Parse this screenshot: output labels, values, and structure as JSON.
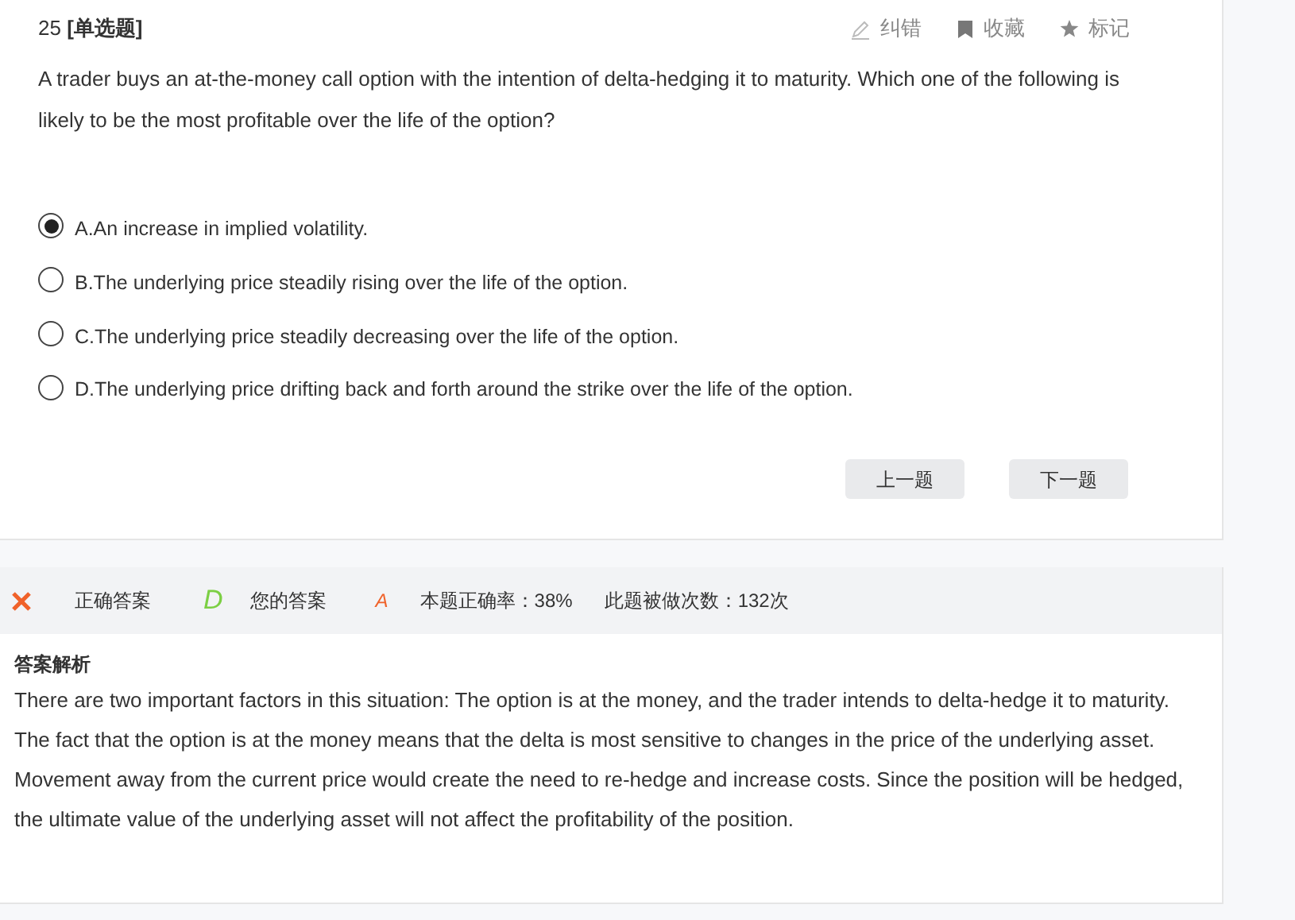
{
  "question": {
    "number": "25",
    "type": "[单选题]",
    "text": "A trader buys an at-the-money call option with the intention of delta-hedging it to maturity. Which one of the following is likely to be the most profitable over the life of the option?"
  },
  "actions": [
    {
      "kind": "report",
      "label": "纠错"
    },
    {
      "kind": "bookmark",
      "label": "收藏"
    },
    {
      "kind": "star",
      "label": "标记"
    }
  ],
  "options": [
    {
      "label": "A.An increase in implied volatility.",
      "selected": true
    },
    {
      "label": "B.The underlying price steadily rising over the life of the option.",
      "selected": false
    },
    {
      "label": "C.The underlying price steadily decreasing over the life of the option.",
      "selected": false
    },
    {
      "label": "D.The underlying price drifting back and forth around the strike over the life of the option.",
      "selected": false
    }
  ],
  "buttons": [
    "上一题",
    "下一题"
  ],
  "result": {
    "correct": false,
    "correct_answer": "D",
    "correct_label": "正确答案",
    "your_answer": "A",
    "your_label": "您的答案",
    "accuracy": "本题正确率：38%",
    "count": "此题被做次数：132次"
  },
  "analysis": {
    "title": "答案解析",
    "text": "There are two important factors in this situation: The option is at the money, and the trader intends to delta-hedge it to maturity. The fact that the option is at the money means that the delta is most sensitive to changes in the price of the underlying asset. Movement away from the current price would create the need to re-hedge and increase costs. Since the position will be hedged, the ultimate value of the underlying asset will not affect the profitability of the position."
  }
}
